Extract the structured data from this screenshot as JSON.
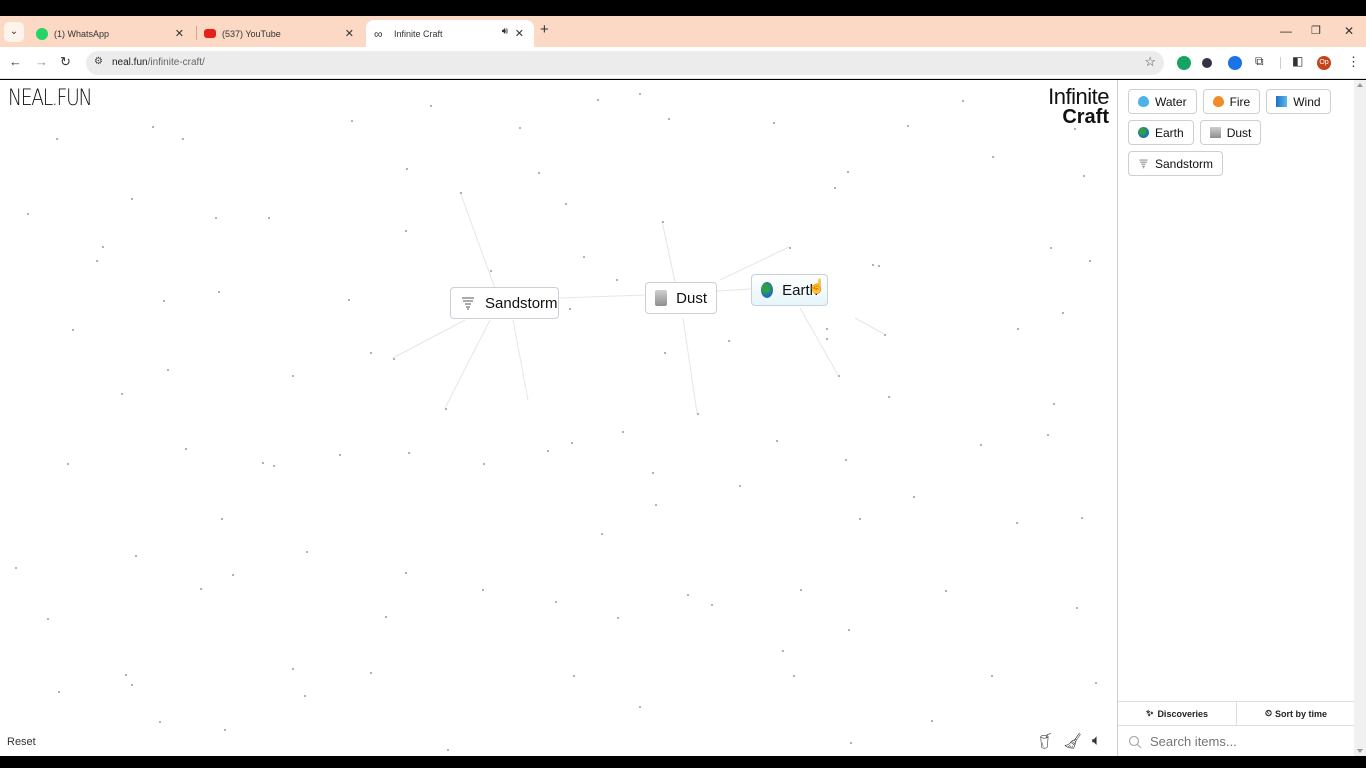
{
  "browser": {
    "tabs": [
      {
        "label": "(1) WhatsApp",
        "icon": "whatsapp-icon",
        "active": false
      },
      {
        "label": "(537) YouTube",
        "icon": "youtube-icon",
        "active": false
      },
      {
        "label": "Infinite Craft",
        "icon": "infinity-icon",
        "active": true,
        "audio": true
      }
    ],
    "new_tab_label": "+",
    "url_domain": "neal.fun",
    "url_path": "/infinite-craft/",
    "profile_initials": "Op"
  },
  "page": {
    "logo": "NEAL.FUN",
    "title_line1": "Infinite",
    "title_line2": "Craft",
    "reset_label": "Reset"
  },
  "canvas_items": [
    {
      "label": "Sandstorm",
      "icon": "tornado-icon"
    },
    {
      "label": "Dust",
      "icon": "dust-icon"
    },
    {
      "label": "Earth",
      "icon": "globe-icon"
    }
  ],
  "sidebar": {
    "items": [
      {
        "label": "Water",
        "icon": "water-drop-icon"
      },
      {
        "label": "Fire",
        "icon": "fire-icon"
      },
      {
        "label": "Wind",
        "icon": "wind-icon"
      },
      {
        "label": "Earth",
        "icon": "globe-icon"
      },
      {
        "label": "Dust",
        "icon": "dust-icon"
      },
      {
        "label": "Sandstorm",
        "icon": "tornado-icon"
      }
    ],
    "discoveries_label": "Discoveries",
    "sort_label": "Sort by time",
    "search_placeholder": "Search items..."
  }
}
